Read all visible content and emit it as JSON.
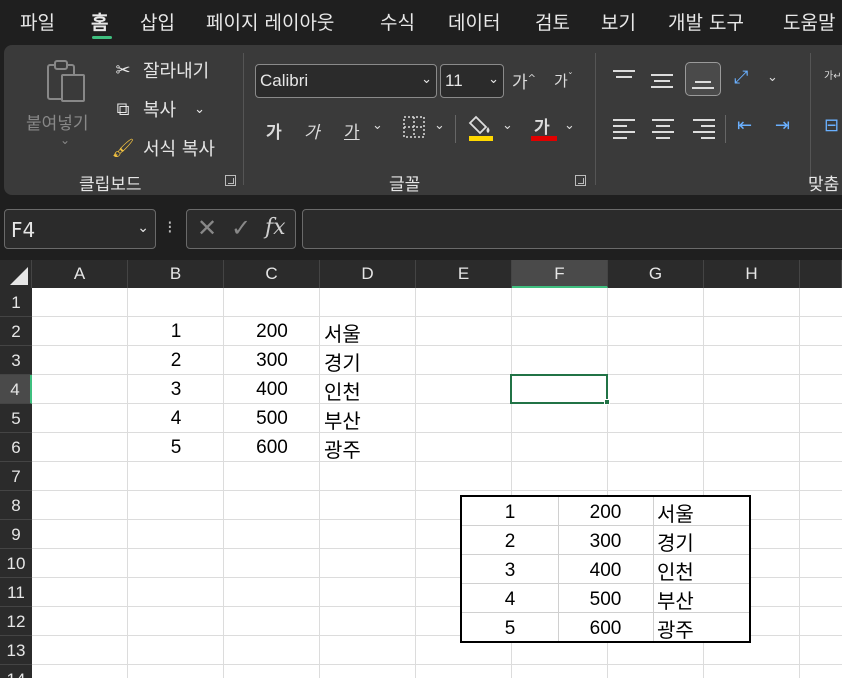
{
  "menu": {
    "tabs": [
      "파일",
      "홈",
      "삽입",
      "페이지 레이아웃",
      "수식",
      "데이터",
      "검토",
      "보기",
      "개발 도구",
      "도움말"
    ],
    "active": "홈"
  },
  "ribbon": {
    "clipboard": {
      "paste_label": "붙여넣기",
      "cut_label": "잘라내기",
      "copy_label": "복사",
      "format_painter_label": "서식 복사",
      "group_label": "클립보드"
    },
    "font": {
      "font_name": "Calibri",
      "font_size": "11",
      "grow_label": "가",
      "shrink_label": "가",
      "bold_label": "가",
      "italic_label": "가",
      "underline_label": "가",
      "font_color_label": "가",
      "group_label": "글꼴"
    },
    "alignment": {
      "group_label": "맞춤"
    }
  },
  "formula_bar": {
    "name_box": "F4",
    "fx_label": "fx",
    "formula": ""
  },
  "grid": {
    "columns": [
      "A",
      "B",
      "C",
      "D",
      "E",
      "F",
      "G",
      "H"
    ],
    "rows": [
      "1",
      "2",
      "3",
      "4",
      "5",
      "6",
      "7",
      "8",
      "9",
      "10",
      "11",
      "12",
      "13",
      "14"
    ],
    "selected_cell": "F4",
    "data": [
      {
        "b": "1",
        "c": "200",
        "d": "서울"
      },
      {
        "b": "2",
        "c": "300",
        "d": "경기"
      },
      {
        "b": "3",
        "c": "400",
        "d": "인천"
      },
      {
        "b": "4",
        "c": "500",
        "d": "부산"
      },
      {
        "b": "5",
        "c": "600",
        "d": "광주"
      }
    ]
  },
  "picture_table": {
    "rows": [
      {
        "a": "1",
        "b": "200",
        "c": "서울"
      },
      {
        "a": "2",
        "b": "300",
        "c": "경기"
      },
      {
        "a": "3",
        "b": "400",
        "c": "인천"
      },
      {
        "a": "4",
        "b": "500",
        "c": "부산"
      },
      {
        "a": "5",
        "b": "600",
        "c": "광주"
      }
    ]
  },
  "colors": {
    "accent": "#217346",
    "tab_underline": "#3fbf7f",
    "highlight_yellow": "#ffd800",
    "font_red": "#e00000"
  }
}
